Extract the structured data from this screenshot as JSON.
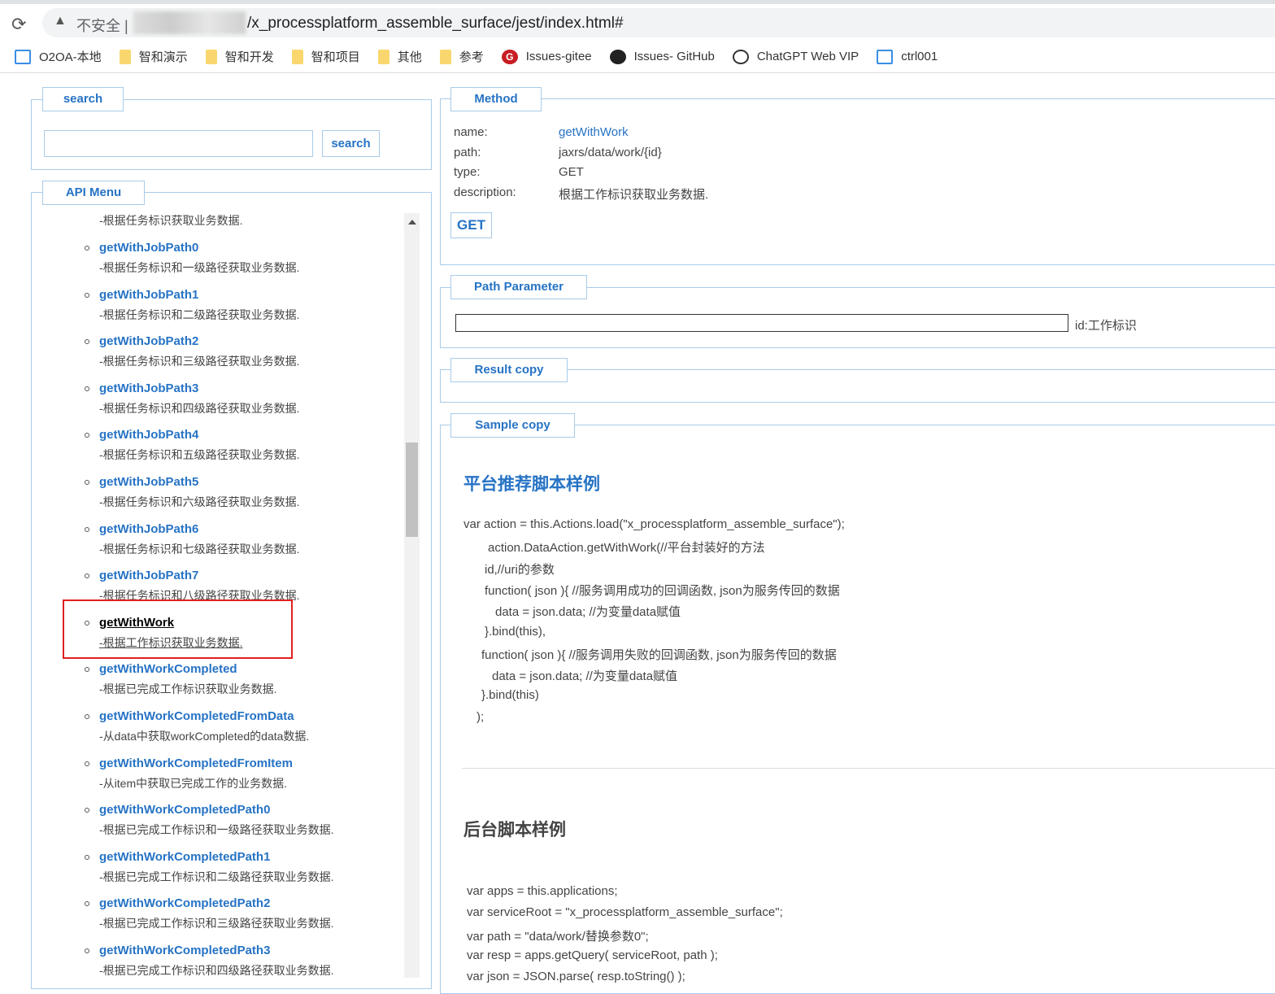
{
  "browser": {
    "insecure": "不安全 |",
    "url": "/x_processplatform_assemble_surface/jest/index.html#",
    "bookmarks": [
      {
        "label": "O2OA-本地",
        "icon": "o2-icon"
      },
      {
        "label": "智和演示",
        "icon": "folder-icon"
      },
      {
        "label": "智和开发",
        "icon": "folder-icon"
      },
      {
        "label": "智和项目",
        "icon": "folder-icon"
      },
      {
        "label": "其他",
        "icon": "folder-icon"
      },
      {
        "label": "参考",
        "icon": "folder-icon"
      },
      {
        "label": "Issues-gitee",
        "icon": "gitee-icon"
      },
      {
        "label": "Issues- GitHub",
        "icon": "github-icon"
      },
      {
        "label": "ChatGPT Web VIP",
        "icon": "openai-icon"
      },
      {
        "label": "ctrl001",
        "icon": "o2-icon"
      }
    ]
  },
  "search": {
    "legend": "search",
    "value": "",
    "button": "search"
  },
  "menu": {
    "legend": "API Menu",
    "first_desc": "-根据任务标识获取业务数据.",
    "items": [
      {
        "name": "getWithJobPath0",
        "desc": "-根据任务标识和一级路径获取业务数据."
      },
      {
        "name": "getWithJobPath1",
        "desc": "-根据任务标识和二级路径获取业务数据."
      },
      {
        "name": "getWithJobPath2",
        "desc": "-根据任务标识和三级路径获取业务数据."
      },
      {
        "name": "getWithJobPath3",
        "desc": "-根据任务标识和四级路径获取业务数据."
      },
      {
        "name": "getWithJobPath4",
        "desc": "-根据任务标识和五级路径获取业务数据."
      },
      {
        "name": "getWithJobPath5",
        "desc": "-根据任务标识和六级路径获取业务数据."
      },
      {
        "name": "getWithJobPath6",
        "desc": "-根据任务标识和七级路径获取业务数据."
      },
      {
        "name": "getWithJobPath7",
        "desc": "-根据任务标识和八级路径获取业务数据."
      },
      {
        "name": "getWithWork",
        "desc": "-根据工作标识获取业务数据.",
        "active": true
      },
      {
        "name": "getWithWorkCompleted",
        "desc": "-根据已完成工作标识获取业务数据."
      },
      {
        "name": "getWithWorkCompletedFromData",
        "desc": "-从data中获取workCompleted的data数据."
      },
      {
        "name": "getWithWorkCompletedFromItem",
        "desc": "-从item中获取已完成工作的业务数据."
      },
      {
        "name": "getWithWorkCompletedPath0",
        "desc": "-根据已完成工作标识和一级路径获取业务数据."
      },
      {
        "name": "getWithWorkCompletedPath1",
        "desc": "-根据已完成工作标识和二级路径获取业务数据."
      },
      {
        "name": "getWithWorkCompletedPath2",
        "desc": "-根据已完成工作标识和三级路径获取业务数据."
      },
      {
        "name": "getWithWorkCompletedPath3",
        "desc": "-根据已完成工作标识和四级路径获取业务数据."
      }
    ]
  },
  "method": {
    "legend": "Method",
    "name_label": "name:",
    "name": "getWithWork",
    "path_label": "path:",
    "path": "jaxrs/data/work/{id}",
    "type_label": "type:",
    "type": "GET",
    "desc_label": "description:",
    "desc": "根据工作标识获取业务数据.",
    "button": "GET"
  },
  "path_param": {
    "legend": "Path Parameter",
    "value": "",
    "label": "id:工作标识"
  },
  "result": {
    "legend": "Result copy"
  },
  "sample": {
    "legend": "Sample copy",
    "title1": "平台推荐脚本样例",
    "code1": [
      "var action = this.Actions.load(\"x_processplatform_assemble_surface\");",
      "action.DataAction.getWithWork(//平台封装好的方法",
      "id,//uri的参数",
      "function( json ){ //服务调用成功的回调函数, json为服务传回的数据",
      "data = json.data; //为变量data赋值",
      "}.bind(this),",
      "function( json ){ //服务调用失败的回调函数, json为服务传回的数据",
      "data = json.data; //为变量data赋值",
      "}.bind(this)",
      ");"
    ],
    "title2": "后台脚本样例",
    "code2": [
      "var apps = this.applications;",
      "var serviceRoot = \"x_processplatform_assemble_surface\";",
      "var path = \"data/work/替换参数0\";",
      "var resp = apps.getQuery( serviceRoot, path );",
      "var json = JSON.parse( resp.toString() );"
    ]
  }
}
